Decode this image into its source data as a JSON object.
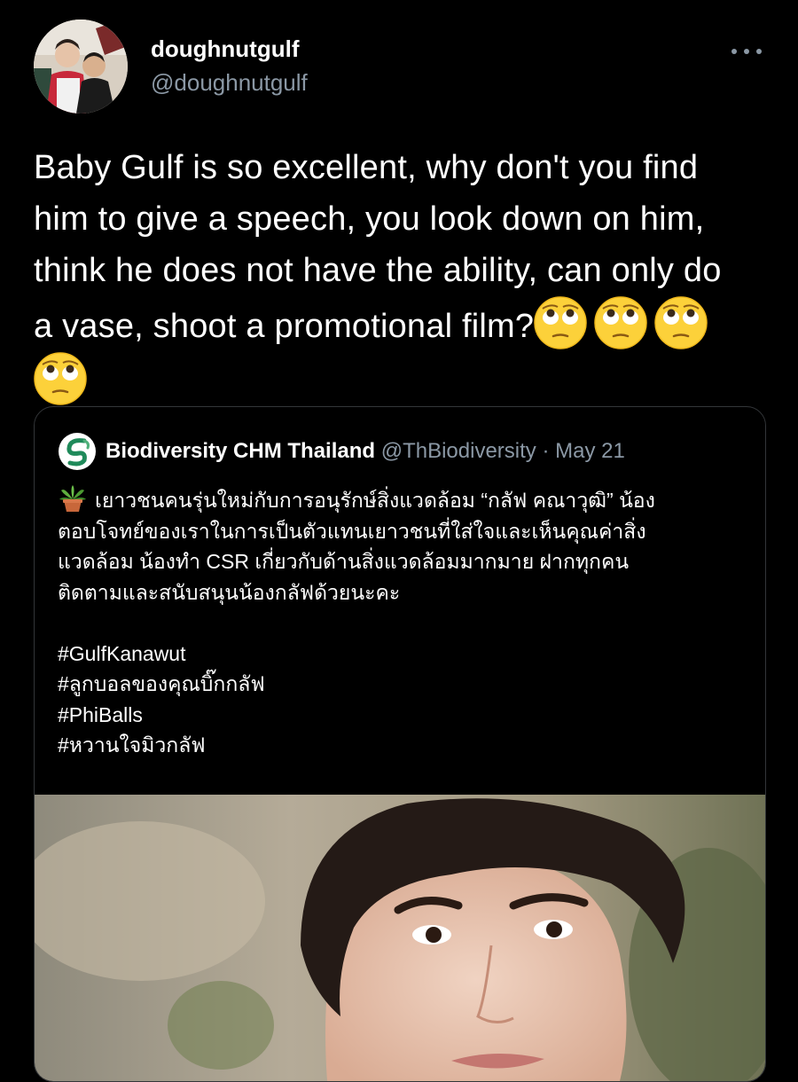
{
  "tweet": {
    "author": {
      "display_name": "doughnutgulf",
      "handle": "@doughnutgulf"
    },
    "text_lines": [
      "Baby Gulf is so excellent, why don't you find",
      "him to give a speech, you look down on him,",
      "think he does not have the ability, can only do",
      "a vase, shoot a promotional film?"
    ],
    "emoji": "face-with-rolling-eyes-emoji",
    "emoji_count": 4
  },
  "quoted_tweet": {
    "author": {
      "display_name": "Biodiversity CHM Thailand",
      "handle": "@ThBiodiversity"
    },
    "separator": "·",
    "date": "May 21",
    "lead_icon": "potted-plant-emoji",
    "body_lines": [
      "เยาวชนคนรุ่นใหม่กับการอนุรักษ์สิ่งแวดล้อม “กลัฟ คณาวุฒิ” น้อง",
      "ตอบโจทย์ของเราในการเป็นตัวแทนเยาวชนที่ใส่ใจและเห็นคุณค่าสิ่ง",
      "แวดล้อม น้องทำ CSR เกี่ยวกับด้านสิ่งแวดล้อมมากมาย ฝากทุกคน",
      "ติดตามและสนับสนุนน้องกลัฟด้วยนะคะ"
    ],
    "hashtags": [
      "#GulfKanawut",
      "#ลูกบอลของคุณบิ๊กกลัฟ",
      "#PhiBalls",
      "#หวานใจมิวกลัฟ"
    ]
  },
  "colors": {
    "background": "#000000",
    "text_primary": "#ffffff",
    "text_secondary": "#8b98a5",
    "border": "#333639"
  }
}
